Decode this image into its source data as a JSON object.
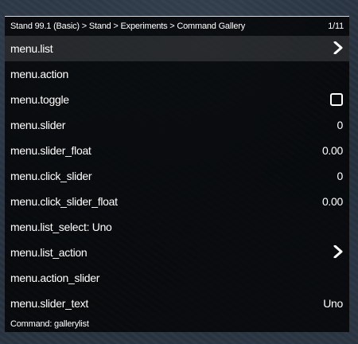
{
  "header": {
    "breadcrumb": "Stand 99.1 (Basic) > Stand > Experiments > Command Gallery",
    "position": "1/11"
  },
  "items": [
    {
      "label": "menu.list",
      "value": "",
      "icon": "chevron-right-icon"
    },
    {
      "label": "menu.action",
      "value": ""
    },
    {
      "label": "menu.toggle",
      "value": "",
      "icon": "checkbox-icon",
      "checked": false
    },
    {
      "label": "menu.slider",
      "value": "0"
    },
    {
      "label": "menu.slider_float",
      "value": "0.00"
    },
    {
      "label": "menu.click_slider",
      "value": "0"
    },
    {
      "label": "menu.click_slider_float",
      "value": "0.00"
    },
    {
      "label": "menu.list_select: Uno",
      "value": ""
    },
    {
      "label": "menu.list_action",
      "value": "",
      "icon": "chevron-right-icon"
    },
    {
      "label": "menu.action_slider",
      "value": ""
    },
    {
      "label": "menu.slider_text",
      "value": "Uno"
    }
  ],
  "footer": {
    "command": "Command: gallerylist"
  },
  "colors": {
    "panel": "#000000",
    "text": "#ffffff",
    "highlight": "#ffffff"
  }
}
